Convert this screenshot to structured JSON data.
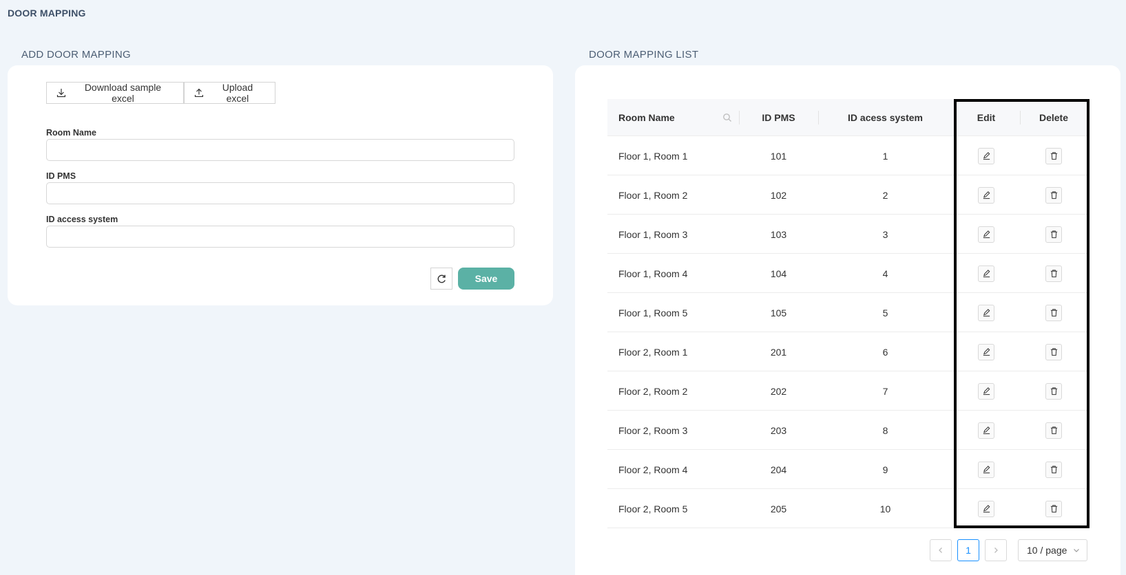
{
  "page_title": "DOOR MAPPING",
  "add_section": {
    "title": "ADD DOOR MAPPING",
    "download_label": "Download sample excel",
    "upload_label": "Upload excel",
    "fields": [
      {
        "label": "Room Name",
        "value": ""
      },
      {
        "label": "ID PMS",
        "value": ""
      },
      {
        "label": "ID access system",
        "value": ""
      }
    ],
    "save_label": "Save"
  },
  "list_section": {
    "title": "DOOR MAPPING LIST",
    "columns": [
      "Room Name",
      "ID PMS",
      "ID acess system",
      "Edit",
      "Delete"
    ],
    "rows": [
      {
        "room": "Floor 1, Room 1",
        "pms": "101",
        "access": "1"
      },
      {
        "room": "Floor 1, Room 2",
        "pms": "102",
        "access": "2"
      },
      {
        "room": "Floor 1, Room 3",
        "pms": "103",
        "access": "3"
      },
      {
        "room": "Floor 1, Room 4",
        "pms": "104",
        "access": "4"
      },
      {
        "room": "Floor 1, Room 5",
        "pms": "105",
        "access": "5"
      },
      {
        "room": "Floor 2, Room 1",
        "pms": "201",
        "access": "6"
      },
      {
        "room": "Floor 2, Room 2",
        "pms": "202",
        "access": "7"
      },
      {
        "room": "Floor 2, Room 3",
        "pms": "203",
        "access": "8"
      },
      {
        "room": "Floor 2, Room 4",
        "pms": "204",
        "access": "9"
      },
      {
        "room": "Floor 2, Room 5",
        "pms": "205",
        "access": "10"
      }
    ],
    "pagination": {
      "current_page": "1",
      "page_size": "10 / page"
    }
  },
  "colors": {
    "save": "#5bb1a5",
    "active_page": "#1890ff",
    "title": "#3e5068"
  }
}
